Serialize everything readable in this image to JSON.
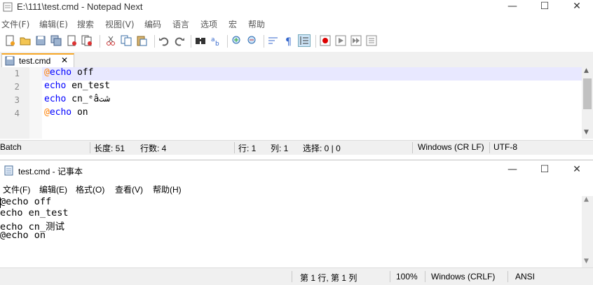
{
  "notepad_next": {
    "title": "E:\\111\\test.cmd - Notepad Next",
    "menu": [
      "文件(F)",
      "编辑(E)",
      "搜索",
      "视图(V)",
      "编码",
      "语言",
      "选项",
      "宏",
      "帮助"
    ],
    "tab_label": "test.cmd",
    "tab_close": "✕",
    "line_numbers": [
      "1",
      "2",
      "3",
      "4"
    ],
    "lines": [
      {
        "at": "@",
        "kw": "echo",
        "rest": " off"
      },
      {
        "at": "",
        "kw": "echo",
        "rest": " en_test"
      },
      {
        "at": "",
        "kw": "echo",
        "rest": " cn_ᵉâشت"
      },
      {
        "at": "@",
        "kw": "echo",
        "rest": " on"
      }
    ],
    "status": {
      "language": "Batch",
      "length": "长度: 51",
      "lines": "行数: 4",
      "line": "行: 1",
      "column": "列: 1",
      "selection": "选择: 0 | 0",
      "eol": "Windows (CR LF)",
      "encoding": "UTF-8"
    }
  },
  "windows_notepad": {
    "title": "test.cmd - 记事本",
    "menu": [
      "文件(F)",
      "编辑(E)",
      "格式(O)",
      "查看(V)",
      "帮助(H)"
    ],
    "lines": [
      "@echo off",
      "echo en_test",
      "echo cn_测试",
      "@echo on"
    ],
    "status": {
      "position": "第 1 行, 第 1 列",
      "zoom": "100%",
      "eol": "Windows (CRLF)",
      "encoding": "ANSI"
    }
  },
  "window_controls": {
    "minimize": "—",
    "maximize": "☐",
    "close": "✕"
  },
  "colors": {
    "keyword": "#0000ff",
    "at_sign": "#ff8000",
    "current_line": "#e8e8ff",
    "tab_accent": "#f5a524"
  },
  "toolbar_icons": [
    "new-file-icon",
    "open-file-icon",
    "save-icon",
    "save-all-icon",
    "close-icon",
    "close-all-icon",
    "cut-icon",
    "copy-icon",
    "paste-icon",
    "undo-icon",
    "redo-icon",
    "find-icon",
    "replace-icon",
    "zoom-in-icon",
    "zoom-out-icon",
    "word-wrap-icon",
    "show-symbols-icon",
    "indent-guide-icon",
    "record-macro-icon",
    "play-macro-icon",
    "run-macro-multiple-icon",
    "save-macro-icon"
  ]
}
